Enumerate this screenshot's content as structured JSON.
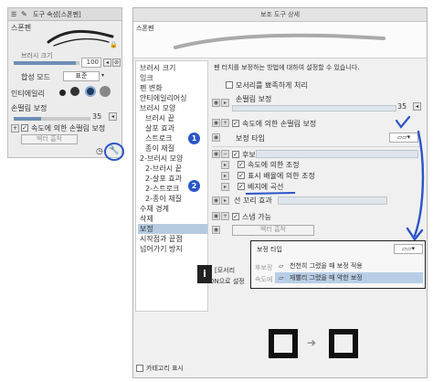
{
  "colors": {
    "accent": "#2a55c8",
    "selection": "#b6cbe0",
    "panel_bg": "#ececec"
  },
  "left_panel": {
    "tab_title": "도구 속성[스폰펜]",
    "tool_name": "스폰펜",
    "brush_size_label": "브러시 크기",
    "brush_size_value": "100",
    "blend_mode_label": "합성 모드",
    "blend_mode_value": "표준",
    "ink_label": "인티에일리",
    "correction_label": "손떨림 보정",
    "correction_value": "35",
    "speed_check_label": "속도에 의한 손떨림 보정",
    "vector_label": "벡터 흡착",
    "icons": [
      "menu-icon",
      "pen-icon",
      "lock-icon",
      "slider-icon",
      "wrench-icon",
      "clock-icon"
    ]
  },
  "detail": {
    "title": "보조 도구 상세",
    "preview_label": "스폰펜",
    "categories": [
      {
        "label": "브러시 크기",
        "sub": false,
        "selected": false
      },
      {
        "label": "잉크",
        "sub": false,
        "selected": false
      },
      {
        "label": "펜 변화",
        "sub": false,
        "selected": false
      },
      {
        "label": "안티에일리어싱",
        "sub": false,
        "selected": false
      },
      {
        "label": "브러시 모양",
        "sub": false,
        "selected": false
      },
      {
        "label": "브러시 끝",
        "sub": true,
        "selected": false
      },
      {
        "label": "살포 효과",
        "sub": true,
        "selected": false
      },
      {
        "label": "스트로크",
        "sub": true,
        "selected": false
      },
      {
        "label": "종이 재질",
        "sub": true,
        "selected": false
      },
      {
        "label": "2-브러시 모양",
        "sub": false,
        "selected": false
      },
      {
        "label": "2-브러시 끝",
        "sub": true,
        "selected": false
      },
      {
        "label": "2-살포 효과",
        "sub": true,
        "selected": false
      },
      {
        "label": "2-스트로크",
        "sub": true,
        "selected": false
      },
      {
        "label": "2-종이 재질",
        "sub": true,
        "selected": false
      },
      {
        "label": "수채 경계",
        "sub": false,
        "selected": false
      },
      {
        "label": "삭제",
        "sub": false,
        "selected": false
      },
      {
        "label": "보정",
        "sub": false,
        "selected": true
      },
      {
        "label": "시작점과 끝점",
        "sub": false,
        "selected": false
      },
      {
        "label": "넘어가기 방지",
        "sub": false,
        "selected": false
      }
    ],
    "description": "펜 터치를 보정하는 방법에 대하여 설정할 수 있습니다.",
    "sharp_corner": "모서리를 뾰족하게 처리",
    "stab_label": "손떨림 보정",
    "stab_value": "35",
    "speed_stab": "속도에 의한 손떨림 보정",
    "correction_type": "보정 타입",
    "post_correction": "후보정",
    "speed_adjust": "속도에 의한 조정",
    "zoom_adjust": "표시 배율에 의한 조정",
    "to_curve": "베지에 곡선",
    "tail_effect": "선 꼬리 효과",
    "snap": "스냅 가능",
    "vector_snap": "벡터 흡착",
    "bottom_text_1": "[모서리",
    "bottom_text_2": "ON으로 설정",
    "category_display": "카테고리 표시",
    "annotations": [
      "1",
      "2"
    ]
  },
  "popup": {
    "title": "보정 타입",
    "side_label": "후보정",
    "side_label_2": "속도에 의",
    "options": [
      {
        "label": "천천히 그렸을 때 보정 적용",
        "selected": false
      },
      {
        "label": "재빨리 그렸을 때 약한 보정",
        "selected": true
      }
    ]
  }
}
